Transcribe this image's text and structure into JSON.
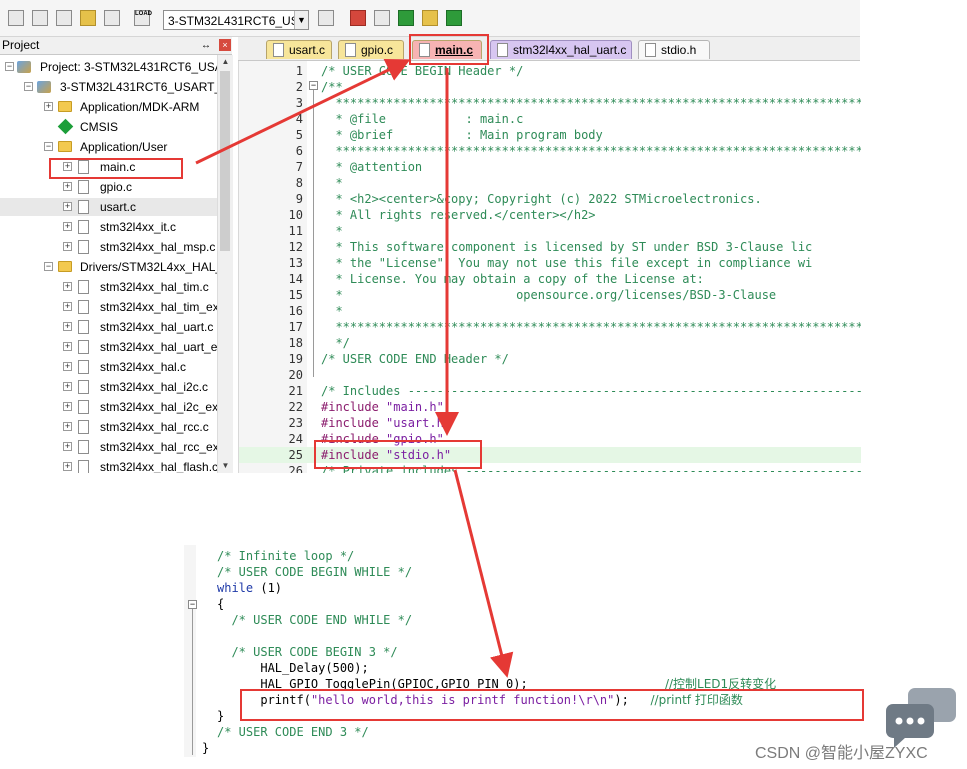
{
  "toolbar": {
    "target_name": "3-STM32L431RCT6_USAR",
    "load_label": "LOAD"
  },
  "project_panel": {
    "title": "Project",
    "pin_glyph": "↔",
    "close_glyph": "×",
    "tree": [
      {
        "label": "Project: 3-STM32L431RCT6_USAR",
        "kind": "root",
        "expander": "−"
      },
      {
        "label": "3-STM32L431RCT6_USART_pri",
        "kind": "target",
        "expander": "−"
      },
      {
        "label": "Application/MDK-ARM",
        "kind": "folder",
        "expander": "+"
      },
      {
        "label": "CMSIS",
        "kind": "gem",
        "expander": ""
      },
      {
        "label": "Application/User",
        "kind": "folder",
        "expander": "−"
      },
      {
        "label": "main.c",
        "kind": "file",
        "expander": "+"
      },
      {
        "label": "gpio.c",
        "kind": "file",
        "expander": "+"
      },
      {
        "label": "usart.c",
        "kind": "file",
        "expander": "+"
      },
      {
        "label": "stm32l4xx_it.c",
        "kind": "file",
        "expander": "+"
      },
      {
        "label": "stm32l4xx_hal_msp.c",
        "kind": "file",
        "expander": "+"
      },
      {
        "label": "Drivers/STM32L4xx_HAL_",
        "kind": "folder",
        "expander": "−"
      },
      {
        "label": "stm32l4xx_hal_tim.c",
        "kind": "file",
        "expander": "+"
      },
      {
        "label": "stm32l4xx_hal_tim_ex",
        "kind": "file",
        "expander": "+"
      },
      {
        "label": "stm32l4xx_hal_uart.c",
        "kind": "file",
        "expander": "+"
      },
      {
        "label": "stm32l4xx_hal_uart_ex",
        "kind": "file",
        "expander": "+"
      },
      {
        "label": "stm32l4xx_hal.c",
        "kind": "file",
        "expander": "+"
      },
      {
        "label": "stm32l4xx_hal_i2c.c",
        "kind": "file",
        "expander": "+"
      },
      {
        "label": "stm32l4xx_hal_i2c_ex.",
        "kind": "file",
        "expander": "+"
      },
      {
        "label": "stm32l4xx_hal_rcc.c",
        "kind": "file",
        "expander": "+"
      },
      {
        "label": "stm32l4xx_hal_rcc_ex.",
        "kind": "file",
        "expander": "+"
      },
      {
        "label": "stm32l4xx_hal_flash.c",
        "kind": "file",
        "expander": "+"
      }
    ]
  },
  "tabs": [
    {
      "label": "usart.c",
      "style": "yellow"
    },
    {
      "label": "gpio.c",
      "style": "yellow"
    },
    {
      "label": "main.c",
      "style": "active"
    },
    {
      "label": "stm32l4xx_hal_uart.c",
      "style": "lav"
    },
    {
      "label": "stdio.h",
      "style": "white"
    }
  ],
  "editor": {
    "lines": [
      {
        "n": "1",
        "cls": "c-comment",
        "text": "/* USER CODE BEGIN Header */"
      },
      {
        "n": "2",
        "cls": "c-comment",
        "text": "/**"
      },
      {
        "n": "3",
        "cls": "c-comment",
        "text": "  ******************************************************************************"
      },
      {
        "n": "4",
        "cls": "c-comment",
        "text": "  * @file           : main.c"
      },
      {
        "n": "5",
        "cls": "c-comment",
        "text": "  * @brief          : Main program body"
      },
      {
        "n": "6",
        "cls": "c-comment",
        "text": "  ******************************************************************************"
      },
      {
        "n": "7",
        "cls": "c-comment",
        "text": "  * @attention"
      },
      {
        "n": "8",
        "cls": "c-comment",
        "text": "  *"
      },
      {
        "n": "9",
        "cls": "c-comment",
        "text": "  * <h2><center>&copy; Copyright (c) 2022 STMicroelectronics."
      },
      {
        "n": "10",
        "cls": "c-comment",
        "text": "  * All rights reserved.</center></h2>"
      },
      {
        "n": "11",
        "cls": "c-comment",
        "text": "  *"
      },
      {
        "n": "12",
        "cls": "c-comment",
        "text": "  * This software component is licensed by ST under BSD 3-Clause lic"
      },
      {
        "n": "13",
        "cls": "c-comment",
        "text": "  * the \"License\"; You may not use this file except in compliance wi"
      },
      {
        "n": "14",
        "cls": "c-comment",
        "text": "  * License. You may obtain a copy of the License at:"
      },
      {
        "n": "15",
        "cls": "c-comment",
        "text": "  *                        opensource.org/licenses/BSD-3-Clause"
      },
      {
        "n": "16",
        "cls": "c-comment",
        "text": "  *"
      },
      {
        "n": "17",
        "cls": "c-comment",
        "text": "  ******************************************************************************"
      },
      {
        "n": "18",
        "cls": "c-comment",
        "text": "  */"
      },
      {
        "n": "19",
        "cls": "c-comment",
        "text": "/* USER CODE END Header */"
      },
      {
        "n": "20",
        "cls": "c-plain",
        "text": ""
      },
      {
        "n": "21",
        "cls": "c-comment",
        "text": "/* Includes ------------------------------------------------------------------"
      },
      {
        "n": "22",
        "cls": "c-pre",
        "pre": "#include ",
        "str": "\"main.h\""
      },
      {
        "n": "23",
        "cls": "c-pre",
        "pre": "#include ",
        "str": "\"usart.h\""
      },
      {
        "n": "24",
        "cls": "c-pre",
        "pre": "#include ",
        "str": "\"gpio.h\""
      },
      {
        "n": "25",
        "cls": "c-pre",
        "pre": "#include ",
        "str": "\"stdio.h\"",
        "highlight": true
      },
      {
        "n": "26",
        "cls": "c-comment",
        "text": "/* Private includes ----------------------------------------------------------"
      }
    ]
  },
  "lower_code": {
    "lines": [
      {
        "indent": "",
        "segs": [
          {
            "c": "c-comment",
            "t": "/* Infinite loop */"
          }
        ]
      },
      {
        "indent": "",
        "segs": [
          {
            "c": "c-comment",
            "t": "/* USER CODE BEGIN WHILE */"
          }
        ]
      },
      {
        "indent": "",
        "segs": [
          {
            "c": "c-kw",
            "t": "while"
          },
          {
            "c": "c-plain",
            "t": " (1)"
          }
        ]
      },
      {
        "indent": "",
        "segs": [
          {
            "c": "c-plain",
            "t": "{"
          }
        ]
      },
      {
        "indent": "  ",
        "segs": [
          {
            "c": "c-comment",
            "t": "/* USER CODE END WHILE */"
          }
        ]
      },
      {
        "indent": "",
        "segs": []
      },
      {
        "indent": "  ",
        "segs": [
          {
            "c": "c-comment",
            "t": "/* USER CODE BEGIN 3 */"
          }
        ]
      },
      {
        "indent": "      ",
        "segs": [
          {
            "c": "c-plain",
            "t": "HAL_Delay(500);"
          }
        ]
      },
      {
        "indent": "      ",
        "segs": [
          {
            "c": "c-plain",
            "t": "HAL_GPIO_TogglePin(GPIOC,GPIO_PIN_0);                   "
          },
          {
            "c": "c-comment",
            "t": "//控制LED1反转变化"
          }
        ]
      },
      {
        "indent": "      ",
        "segs": [
          {
            "c": "c-plain",
            "t": "printf("
          },
          {
            "c": "c-str",
            "t": "\"hello world,this is printf function!\\r\\n\""
          },
          {
            "c": "c-plain",
            "t": ");   "
          },
          {
            "c": "c-comment",
            "t": "//printf 打印函数"
          }
        ]
      },
      {
        "indent": "",
        "segs": [
          {
            "c": "c-plain",
            "t": "}"
          }
        ]
      },
      {
        "indent": "",
        "segs": [
          {
            "c": "c-comment",
            "t": "/* USER CODE END 3 */"
          }
        ]
      },
      {
        "indent": "",
        "segs": [
          {
            "c": "c-plain",
            "t": "}"
          }
        ]
      }
    ]
  },
  "watermark": {
    "text": "CSDN @智能小屋ZYXC"
  },
  "colors": {
    "annotation_red": "#e53935",
    "active_tab": "#f7b3b3",
    "line_highlight": "#e5f7e5"
  }
}
